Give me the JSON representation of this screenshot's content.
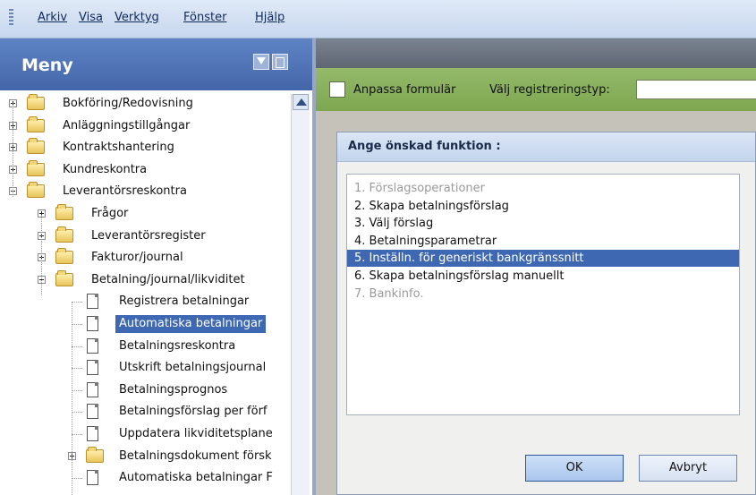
{
  "menubar": {
    "items": [
      "Arkiv",
      "Visa",
      "Verktyg",
      "Fönster",
      "Hjälp"
    ]
  },
  "leftpanel": {
    "title": "Meny",
    "tree": [
      {
        "label": "Bokföring/Redovisning",
        "type": "folder",
        "expand": "plus",
        "level": 0
      },
      {
        "label": "Anläggningstillgångar",
        "type": "folder",
        "expand": "plus",
        "level": 0
      },
      {
        "label": "Kontraktshantering",
        "type": "folder",
        "expand": "plus",
        "level": 0
      },
      {
        "label": "Kundreskontra",
        "type": "folder",
        "expand": "plus",
        "level": 0
      },
      {
        "label": "Leverantörsreskontra",
        "type": "folder",
        "expand": "minus",
        "level": 0
      },
      {
        "label": "Frågor",
        "type": "folder",
        "expand": "plus",
        "level": 1
      },
      {
        "label": "Leverantörsregister",
        "type": "folder",
        "expand": "plus",
        "level": 1
      },
      {
        "label": "Fakturor/journal",
        "type": "folder",
        "expand": "plus",
        "level": 1
      },
      {
        "label": "Betalning/journal/likviditet",
        "type": "folder",
        "expand": "minus",
        "level": 1
      },
      {
        "label": "Registrera betalningar",
        "type": "doc",
        "level": 2
      },
      {
        "label": "Automatiska betalningar",
        "type": "doc",
        "level": 2,
        "selected": true
      },
      {
        "label": "Betalningsreskontra",
        "type": "doc",
        "level": 2
      },
      {
        "label": "Utskrift betalningsjournal",
        "type": "doc",
        "level": 2
      },
      {
        "label": "Betalningsprognos",
        "type": "doc",
        "level": 2
      },
      {
        "label": "Betalningsförslag per förf",
        "type": "doc",
        "level": 2
      },
      {
        "label": "Uppdatera likviditetsplane",
        "type": "doc",
        "level": 2
      },
      {
        "label": "Betalningsdokument försk",
        "type": "folder",
        "expand": "plus",
        "level": 2
      },
      {
        "label": "Automatiska betalningar F",
        "type": "doc",
        "level": 2
      }
    ]
  },
  "toolbar": {
    "customize_label": "Anpassa formulär",
    "regtype_label": "Välj registreringstyp:",
    "regtype_value": ""
  },
  "dialog": {
    "title": "Ange önskad funktion :",
    "options": [
      {
        "label": "1. Förslagsoperationer",
        "disabled": true
      },
      {
        "label": "2. Skapa betalningsförslag"
      },
      {
        "label": "3. Välj förslag"
      },
      {
        "label": "4. Betalningsparametrar"
      },
      {
        "label": "5. Inställn. för generiskt bankgränssnitt",
        "selected": true
      },
      {
        "label": "6. Skapa betalningsförslag manuellt"
      },
      {
        "label": "7. Bankinfo.",
        "disabled": true
      }
    ],
    "ok_label": "OK",
    "cancel_label": "Avbryt"
  }
}
